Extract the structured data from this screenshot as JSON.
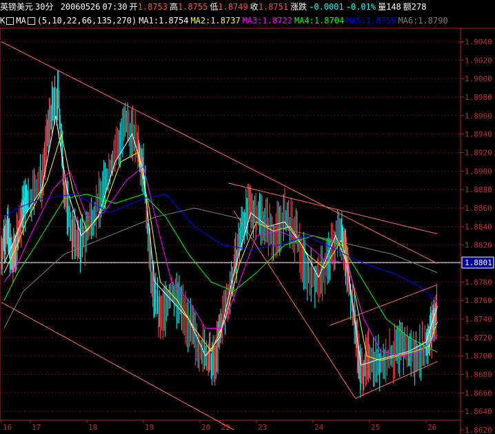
{
  "header": {
    "instrument": "英镑美元",
    "period": "30分",
    "date": "20060526",
    "time": "07:30",
    "open_label": "开",
    "open": "1.8753",
    "high_label": "高",
    "high": "1.8755",
    "low_label": "低",
    "low": "1.8749",
    "close_label": "收",
    "close": "1.8751",
    "change_label": "涨跌",
    "change": "-0.0001",
    "change_pct": "-0.01%",
    "volume_label": "量",
    "volume": "148",
    "amount_label": "额",
    "amount": "278"
  },
  "ma_bar": {
    "k_label": "K",
    "ma_label": "MA",
    "params": "(5,10,22,66,135,270)",
    "items": [
      {
        "label": "MA1:",
        "value": "1.8754",
        "color": "#ffffff"
      },
      {
        "label": "MA2:",
        "value": "1.8737",
        "color": "#ffff00"
      },
      {
        "label": "MA3:",
        "value": "1.8722",
        "color": "#ff00ff"
      },
      {
        "label": "MA4:",
        "value": "1.8704",
        "color": "#00ff00"
      },
      {
        "label": "MA5:",
        "value": "1.8759",
        "color": "#0000ff"
      },
      {
        "label": "MA6:",
        "value": "1.8790",
        "color": "#808080"
      }
    ]
  },
  "chart_data": {
    "type": "candlestick",
    "ylim": [
      1.862,
      1.905
    ],
    "y_ticks": [
      "1.9040",
      "1.9020",
      "1.9000",
      "1.8980",
      "1.8960",
      "1.8940",
      "1.8920",
      "1.8900",
      "1.8880",
      "1.8860",
      "1.8840",
      "1.8820",
      "1.8800",
      "1.8780",
      "1.8760",
      "1.8740",
      "1.8720",
      "1.8700",
      "1.8680",
      "1.8660",
      "1.8640",
      "1.8620"
    ],
    "x_ticks": [
      {
        "label": "16",
        "x": 0
      },
      {
        "label": "17",
        "x": 1
      },
      {
        "label": "18",
        "x": 2
      },
      {
        "label": "19",
        "x": 3
      },
      {
        "label": "20",
        "x": 4
      },
      {
        "label": "22",
        "x": 4.35
      },
      {
        "label": "23",
        "x": 5
      },
      {
        "label": "24",
        "x": 6
      },
      {
        "label": "25",
        "x": 7
      },
      {
        "label": "26",
        "x": 8
      }
    ],
    "xlim": [
      0,
      8.6
    ],
    "current_price": "1.8801",
    "price_path": [
      [
        0.0,
        1.881
      ],
      [
        0.2,
        1.884
      ],
      [
        0.4,
        1.88
      ],
      [
        0.6,
        1.883
      ],
      [
        0.8,
        1.886
      ],
      [
        1.0,
        1.887
      ],
      [
        1.2,
        1.889
      ],
      [
        1.35,
        1.896
      ],
      [
        1.5,
        1.898
      ],
      [
        1.6,
        1.888
      ],
      [
        1.75,
        1.883
      ],
      [
        1.9,
        1.882
      ],
      [
        2.1,
        1.885
      ],
      [
        2.3,
        1.888
      ],
      [
        2.5,
        1.892
      ],
      [
        2.7,
        1.895
      ],
      [
        2.9,
        1.893
      ],
      [
        3.0,
        1.89
      ],
      [
        3.15,
        1.878
      ],
      [
        3.3,
        1.874
      ],
      [
        3.5,
        1.877
      ],
      [
        3.7,
        1.875
      ],
      [
        3.9,
        1.872
      ],
      [
        4.1,
        1.87
      ],
      [
        4.25,
        1.869
      ],
      [
        4.4,
        1.874
      ],
      [
        4.6,
        1.879
      ],
      [
        4.75,
        1.884
      ],
      [
        4.9,
        1.886
      ],
      [
        5.1,
        1.885
      ],
      [
        5.3,
        1.883
      ],
      [
        5.5,
        1.885
      ],
      [
        5.7,
        1.883
      ],
      [
        5.9,
        1.879
      ],
      [
        6.1,
        1.878
      ],
      [
        6.3,
        1.881
      ],
      [
        6.5,
        1.884
      ],
      [
        6.6,
        1.88
      ],
      [
        6.75,
        1.873
      ],
      [
        6.85,
        1.868
      ],
      [
        7.0,
        1.87
      ],
      [
        7.2,
        1.869
      ],
      [
        7.4,
        1.87
      ],
      [
        7.6,
        1.871
      ],
      [
        7.8,
        1.87
      ],
      [
        8.0,
        1.871
      ],
      [
        8.1,
        1.873
      ],
      [
        8.2,
        1.8753
      ]
    ],
    "series": [
      {
        "name": "MA1",
        "color": "#ffffff",
        "values": [
          [
            0.1,
            1.88
          ],
          [
            0.4,
            1.882
          ],
          [
            0.8,
            1.885
          ],
          [
            1.2,
            1.888
          ],
          [
            1.45,
            1.896
          ],
          [
            1.65,
            1.888
          ],
          [
            1.9,
            1.883
          ],
          [
            2.2,
            1.885
          ],
          [
            2.5,
            1.891
          ],
          [
            2.8,
            1.894
          ],
          [
            3.0,
            1.89
          ],
          [
            3.2,
            1.878
          ],
          [
            3.5,
            1.876
          ],
          [
            3.8,
            1.874
          ],
          [
            4.1,
            1.87
          ],
          [
            4.35,
            1.872
          ],
          [
            4.6,
            1.879
          ],
          [
            4.9,
            1.8855
          ],
          [
            5.2,
            1.884
          ],
          [
            5.5,
            1.8845
          ],
          [
            5.8,
            1.882
          ],
          [
            6.1,
            1.8785
          ],
          [
            6.4,
            1.883
          ],
          [
            6.6,
            1.88
          ],
          [
            6.85,
            1.869
          ],
          [
            7.1,
            1.8695
          ],
          [
            7.4,
            1.87
          ],
          [
            7.7,
            1.8705
          ],
          [
            8.0,
            1.8715
          ],
          [
            8.2,
            1.8754
          ]
        ]
      },
      {
        "name": "MA2",
        "color": "#ffff00",
        "values": [
          [
            0.1,
            1.879
          ],
          [
            0.5,
            1.8815
          ],
          [
            0.9,
            1.8845
          ],
          [
            1.3,
            1.889
          ],
          [
            1.55,
            1.894
          ],
          [
            1.75,
            1.888
          ],
          [
            2.0,
            1.8835
          ],
          [
            2.3,
            1.886
          ],
          [
            2.6,
            1.891
          ],
          [
            2.9,
            1.892
          ],
          [
            3.1,
            1.886
          ],
          [
            3.3,
            1.878
          ],
          [
            3.6,
            1.876
          ],
          [
            3.9,
            1.873
          ],
          [
            4.2,
            1.8705
          ],
          [
            4.45,
            1.874
          ],
          [
            4.7,
            1.88
          ],
          [
            5.0,
            1.8845
          ],
          [
            5.3,
            1.8835
          ],
          [
            5.6,
            1.884
          ],
          [
            5.9,
            1.881
          ],
          [
            6.2,
            1.8795
          ],
          [
            6.5,
            1.8825
          ],
          [
            6.7,
            1.878
          ],
          [
            6.95,
            1.87
          ],
          [
            7.2,
            1.8695
          ],
          [
            7.5,
            1.87
          ],
          [
            7.8,
            1.8705
          ],
          [
            8.05,
            1.871
          ],
          [
            8.2,
            1.8737
          ]
        ]
      },
      {
        "name": "MA3",
        "color": "#ff00ff",
        "values": [
          [
            0.1,
            1.878
          ],
          [
            0.6,
            1.88
          ],
          [
            1.0,
            1.883
          ],
          [
            1.4,
            1.888
          ],
          [
            1.7,
            1.89
          ],
          [
            2.0,
            1.885
          ],
          [
            2.3,
            1.8855
          ],
          [
            2.7,
            1.889
          ],
          [
            3.0,
            1.8905
          ],
          [
            3.25,
            1.884
          ],
          [
            3.5,
            1.878
          ],
          [
            3.8,
            1.876
          ],
          [
            4.1,
            1.873
          ],
          [
            4.4,
            1.873
          ],
          [
            4.7,
            1.878
          ],
          [
            5.0,
            1.883
          ],
          [
            5.4,
            1.8835
          ],
          [
            5.8,
            1.8825
          ],
          [
            6.2,
            1.8805
          ],
          [
            6.6,
            1.88
          ],
          [
            6.9,
            1.874
          ],
          [
            7.2,
            1.8705
          ],
          [
            7.6,
            1.87
          ],
          [
            7.9,
            1.8705
          ],
          [
            8.2,
            1.8722
          ]
        ]
      },
      {
        "name": "MA4",
        "color": "#00ff00",
        "values": [
          [
            0.1,
            1.876
          ],
          [
            0.6,
            1.879
          ],
          [
            1.1,
            1.882
          ],
          [
            1.6,
            1.887
          ],
          [
            2.0,
            1.8875
          ],
          [
            2.5,
            1.8865
          ],
          [
            3.0,
            1.8875
          ],
          [
            3.4,
            1.885
          ],
          [
            3.8,
            1.881
          ],
          [
            4.2,
            1.878
          ],
          [
            4.6,
            1.877
          ],
          [
            5.0,
            1.879
          ],
          [
            5.5,
            1.882
          ],
          [
            6.0,
            1.883
          ],
          [
            6.5,
            1.882
          ],
          [
            6.9,
            1.878
          ],
          [
            7.3,
            1.874
          ],
          [
            7.7,
            1.872
          ],
          [
            8.0,
            1.871
          ],
          [
            8.2,
            1.8704
          ]
        ]
      },
      {
        "name": "MA5",
        "color": "#0000ff",
        "values": [
          [
            0.1,
            1.885
          ],
          [
            0.6,
            1.886
          ],
          [
            1.2,
            1.887
          ],
          [
            1.8,
            1.8875
          ],
          [
            2.4,
            1.8855
          ],
          [
            3.0,
            1.887
          ],
          [
            3.4,
            1.8875
          ],
          [
            3.9,
            1.884
          ],
          [
            4.4,
            1.882
          ],
          [
            4.9,
            1.8815
          ],
          [
            5.4,
            1.882
          ],
          [
            5.9,
            1.883
          ],
          [
            6.4,
            1.8815
          ],
          [
            6.9,
            1.88
          ],
          [
            7.4,
            1.879
          ],
          [
            7.9,
            1.8775
          ],
          [
            8.2,
            1.8759
          ]
        ]
      },
      {
        "name": "MA6",
        "color": "#808080",
        "values": [
          [
            0.1,
            1.873
          ],
          [
            0.8,
            1.877
          ],
          [
            1.6,
            1.881
          ],
          [
            2.4,
            1.883
          ],
          [
            3.2,
            1.885
          ],
          [
            3.9,
            1.886
          ],
          [
            4.6,
            1.885
          ],
          [
            5.3,
            1.884
          ],
          [
            6.0,
            1.883
          ],
          [
            6.7,
            1.882
          ],
          [
            7.4,
            1.881
          ],
          [
            8.0,
            1.8795
          ],
          [
            8.2,
            1.879
          ]
        ]
      }
    ],
    "trendlines": [
      {
        "x1": 0.0,
        "y1": 1.904,
        "x2": 8.2,
        "y2": 1.88
      },
      {
        "x1": 0.0,
        "y1": 1.8758,
        "x2": 4.6,
        "y2": 1.862
      },
      {
        "x1": 4.5,
        "y1": 1.8887,
        "x2": 8.2,
        "y2": 1.8832
      },
      {
        "x1": 4.6,
        "y1": 1.8857,
        "x2": 6.75,
        "y2": 1.8654
      },
      {
        "x1": 6.3,
        "y1": 1.8733,
        "x2": 8.2,
        "y2": 1.8777
      },
      {
        "x1": 6.75,
        "y1": 1.8654,
        "x2": 8.2,
        "y2": 1.8694
      }
    ]
  },
  "colors": {
    "axis": "#c02020",
    "grid": "#6a1010",
    "tick_text": "#c03030",
    "trendline": "#ff7060",
    "price_box_bg": "#0000a0"
  }
}
